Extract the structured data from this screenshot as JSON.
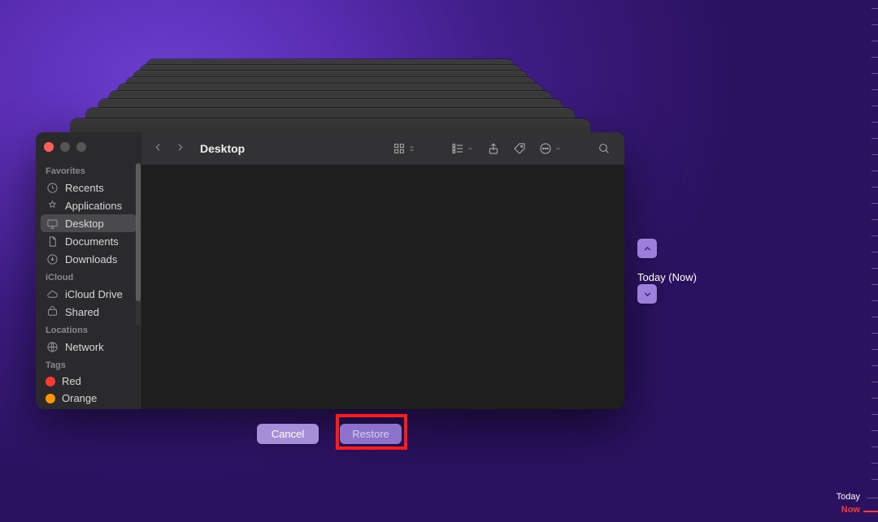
{
  "window": {
    "title": "Desktop"
  },
  "sidebar": {
    "sections": {
      "favorites": "Favorites",
      "icloud": "iCloud",
      "locations": "Locations",
      "tags": "Tags"
    },
    "favorites": [
      {
        "label": "Recents",
        "icon": "clock-icon"
      },
      {
        "label": "Applications",
        "icon": "applications-icon"
      },
      {
        "label": "Desktop",
        "icon": "desktop-icon",
        "selected": true
      },
      {
        "label": "Documents",
        "icon": "document-icon"
      },
      {
        "label": "Downloads",
        "icon": "downloads-icon"
      }
    ],
    "icloud": [
      {
        "label": "iCloud Drive",
        "icon": "cloud-icon"
      },
      {
        "label": "Shared",
        "icon": "shared-icon"
      }
    ],
    "locations": [
      {
        "label": "Network",
        "icon": "network-icon"
      }
    ],
    "tags": [
      {
        "label": "Red",
        "color": "#ff3b30"
      },
      {
        "label": "Orange",
        "color": "#ff9500"
      }
    ]
  },
  "timeline": {
    "current_label": "Today (Now)",
    "ruler": {
      "today_label": "Today",
      "now_label": "Now"
    }
  },
  "buttons": {
    "cancel": "Cancel",
    "restore": "Restore"
  },
  "annotation": {
    "highlight_target": "restore-button"
  }
}
